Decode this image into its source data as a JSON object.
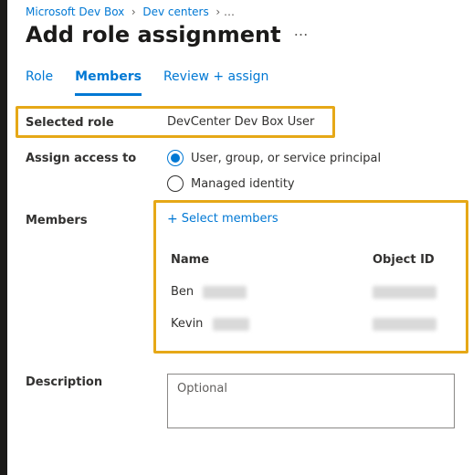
{
  "breadcrumb": {
    "segment1": "Microsoft Dev Box",
    "segment2": "Dev centers"
  },
  "page": {
    "title": "Add role assignment"
  },
  "tabs": {
    "role": "Role",
    "members": "Members",
    "review": "Review + assign"
  },
  "selectedRole": {
    "label": "Selected role",
    "value": "DevCenter Dev Box User"
  },
  "assignAccess": {
    "label": "Assign access to",
    "option1": "User, group, or service principal",
    "option2": "Managed identity"
  },
  "members": {
    "label": "Members",
    "selectLink": "Select members",
    "headerName": "Name",
    "headerObjectId": "Object ID",
    "rows": [
      {
        "name": "Ben"
      },
      {
        "name": "Kevin"
      }
    ]
  },
  "description": {
    "label": "Description",
    "placeholder": "Optional"
  }
}
